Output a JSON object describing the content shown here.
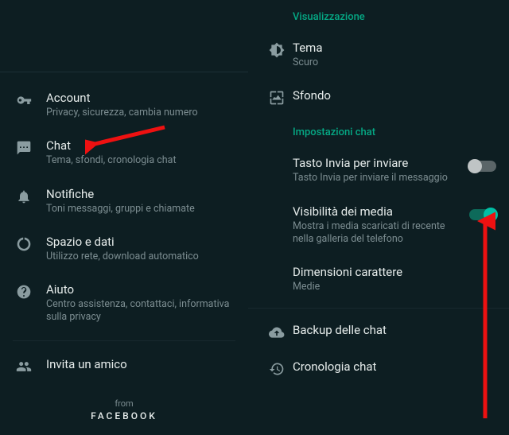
{
  "left": {
    "account": {
      "title": "Account",
      "sub": "Privacy, sicurezza, cambia numero"
    },
    "chat": {
      "title": "Chat",
      "sub": "Tema, sfondi, cronologia chat"
    },
    "notifiche": {
      "title": "Notifiche",
      "sub": "Toni messaggi, gruppi e chiamate"
    },
    "dati": {
      "title": "Spazio e dati",
      "sub": "Utilizzo rete, download automatico"
    },
    "aiuto": {
      "title": "Aiuto",
      "sub": "Centro assistenza, contattaci, informativa sulla privacy"
    },
    "invita": {
      "title": "Invita un amico"
    },
    "from": "from",
    "facebook": "FACEBOOK"
  },
  "right": {
    "visual_header": "Visualizzazione",
    "tema": {
      "title": "Tema",
      "sub": "Scuro"
    },
    "sfondo": {
      "title": "Sfondo"
    },
    "chat_header": "Impostazioni chat",
    "invia": {
      "title": "Tasto Invia per inviare",
      "sub": "Tasto Invia per inviare il messaggio"
    },
    "media": {
      "title": "Visibilità dei media",
      "sub": "Mostra i media scaricati di recente nella galleria del telefono"
    },
    "dim": {
      "title": "Dimensioni carattere",
      "sub": "Medie"
    },
    "backup": {
      "title": "Backup delle chat"
    },
    "cron": {
      "title": "Cronologia chat"
    }
  }
}
